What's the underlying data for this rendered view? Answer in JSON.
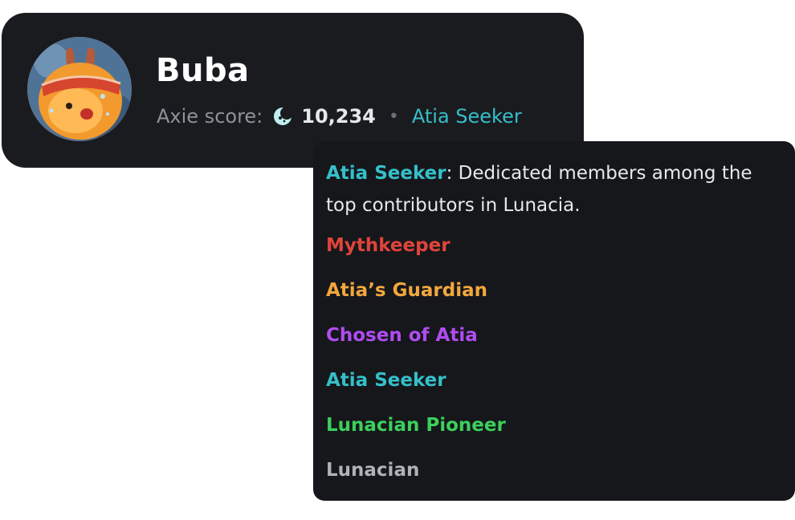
{
  "profile": {
    "name": "Buba",
    "score_label": "Axie score:",
    "score_icon": "moon-icon",
    "score_value": "10,234",
    "separator": "•",
    "rank": "Atia Seeker",
    "rank_color": "#35bfc9"
  },
  "tooltip": {
    "highlight_rank": "Atia Seeker",
    "description": ": Dedicated members among the top contributors in Lunacia.",
    "ranks": [
      {
        "label": "Mythkeeper",
        "color": "#e0443a"
      },
      {
        "label": "Atia’s Guardian",
        "color": "#f3a73c"
      },
      {
        "label": "Chosen of Atia",
        "color": "#b14cf2"
      },
      {
        "label": "Atia Seeker",
        "color": "#35bfc9"
      },
      {
        "label": "Lunacian Pioneer",
        "color": "#3ccf5c"
      },
      {
        "label": "Lunacian",
        "color": "#aeb2b9"
      }
    ]
  },
  "colors": {
    "card_bg": "#1a1b1f",
    "tooltip_bg": "#15171b",
    "text_primary": "#ffffff",
    "text_muted": "#8d929b"
  }
}
